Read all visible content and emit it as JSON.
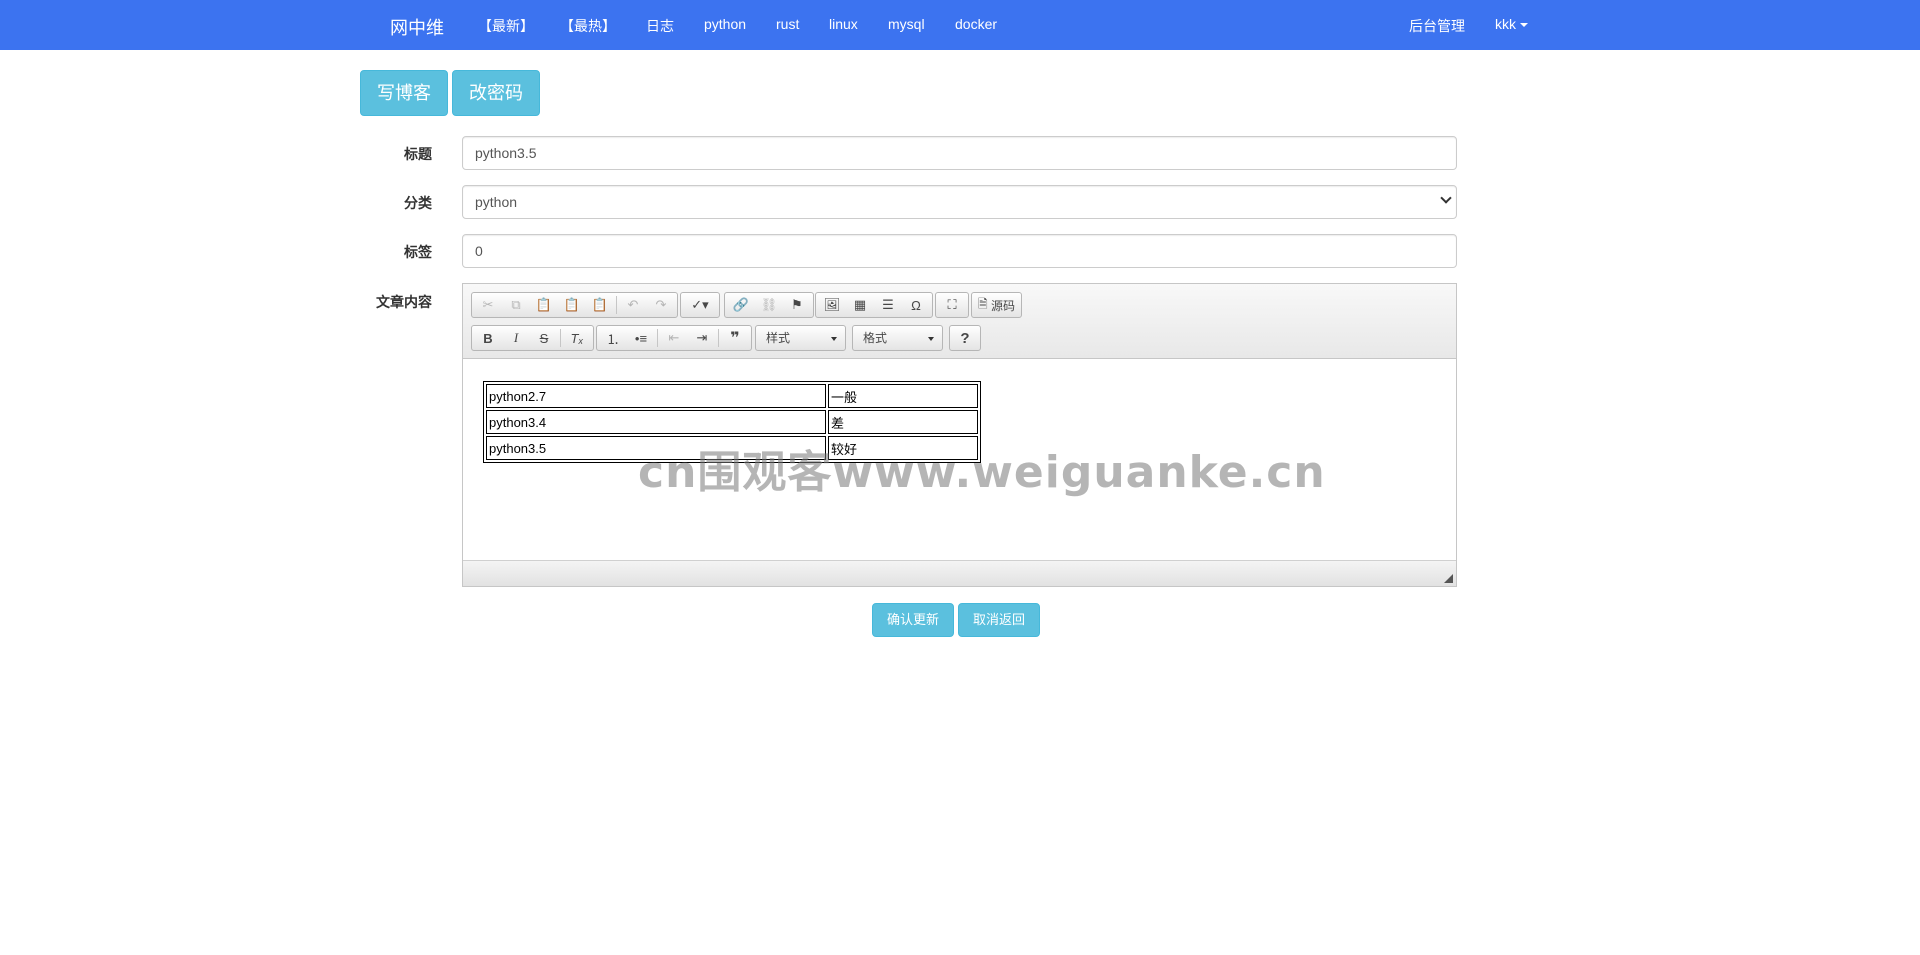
{
  "navbar": {
    "brand": "网中维",
    "items": [
      {
        "label": "【最新】"
      },
      {
        "label": "【最热】"
      },
      {
        "label": "日志"
      },
      {
        "label": "python"
      },
      {
        "label": "rust"
      },
      {
        "label": "linux"
      },
      {
        "label": "mysql"
      },
      {
        "label": "docker"
      }
    ],
    "admin": "后台管理",
    "user": "kkk"
  },
  "actions": {
    "write_blog": "写博客",
    "change_password": "改密码"
  },
  "form": {
    "title_label": "标题",
    "title_value": "python3.5",
    "category_label": "分类",
    "category_value": "python",
    "tags_label": "标签",
    "tags_value": "0",
    "content_label": "文章内容"
  },
  "editor": {
    "source_label": "源码",
    "styles_label": "样式",
    "format_label": "格式",
    "table": [
      [
        "python2.7",
        "一般"
      ],
      [
        "python3.4",
        "差"
      ],
      [
        "python3.5",
        "较好"
      ]
    ]
  },
  "watermark": "cn围观客www.weiguanke.cn",
  "buttons": {
    "confirm": "确认更新",
    "cancel": "取消返回"
  },
  "colors": {
    "navbar": "#3c73f0",
    "info_button": "#5bc0de"
  }
}
